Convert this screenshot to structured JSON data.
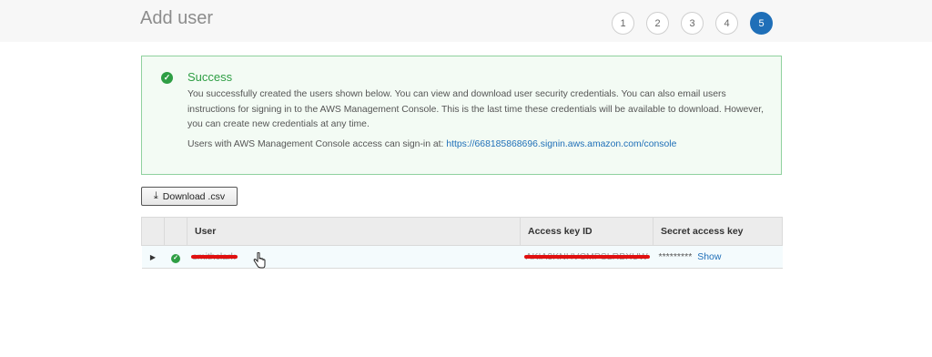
{
  "page": {
    "title": "Add user"
  },
  "steps": [
    {
      "label": "1",
      "active": false
    },
    {
      "label": "2",
      "active": false
    },
    {
      "label": "3",
      "active": false
    },
    {
      "label": "4",
      "active": false
    },
    {
      "label": "5",
      "active": true
    }
  ],
  "success": {
    "icon": "check-circle-icon",
    "title": "Success",
    "message": "You successfully created the users shown below. You can view and download user security credentials. You can also email users instructions for signing in to the AWS Management Console. This is the last time these credentials will be available to download. However, you can create new credentials at any time.",
    "signin_prefix": "Users with AWS Management Console access can sign-in at:",
    "signin_url": "https://668185868696.signin.aws.amazon.com/console"
  },
  "toolbar": {
    "download_label": "Download .csv",
    "download_icon": "download-icon"
  },
  "table": {
    "headers": {
      "expand": "",
      "status": "",
      "user": "User",
      "access_key": "Access key ID",
      "secret_key": "Secret access key"
    },
    "rows": [
      {
        "user": "smithclark",
        "access_key_id": "AKIA3KNHVCMPSLRBXUW",
        "secret_masked": "*********",
        "show_label": "Show"
      }
    ]
  },
  "colors": {
    "accent": "#1f6fb8",
    "success": "#2e9e44",
    "redaction": "#e01010"
  }
}
